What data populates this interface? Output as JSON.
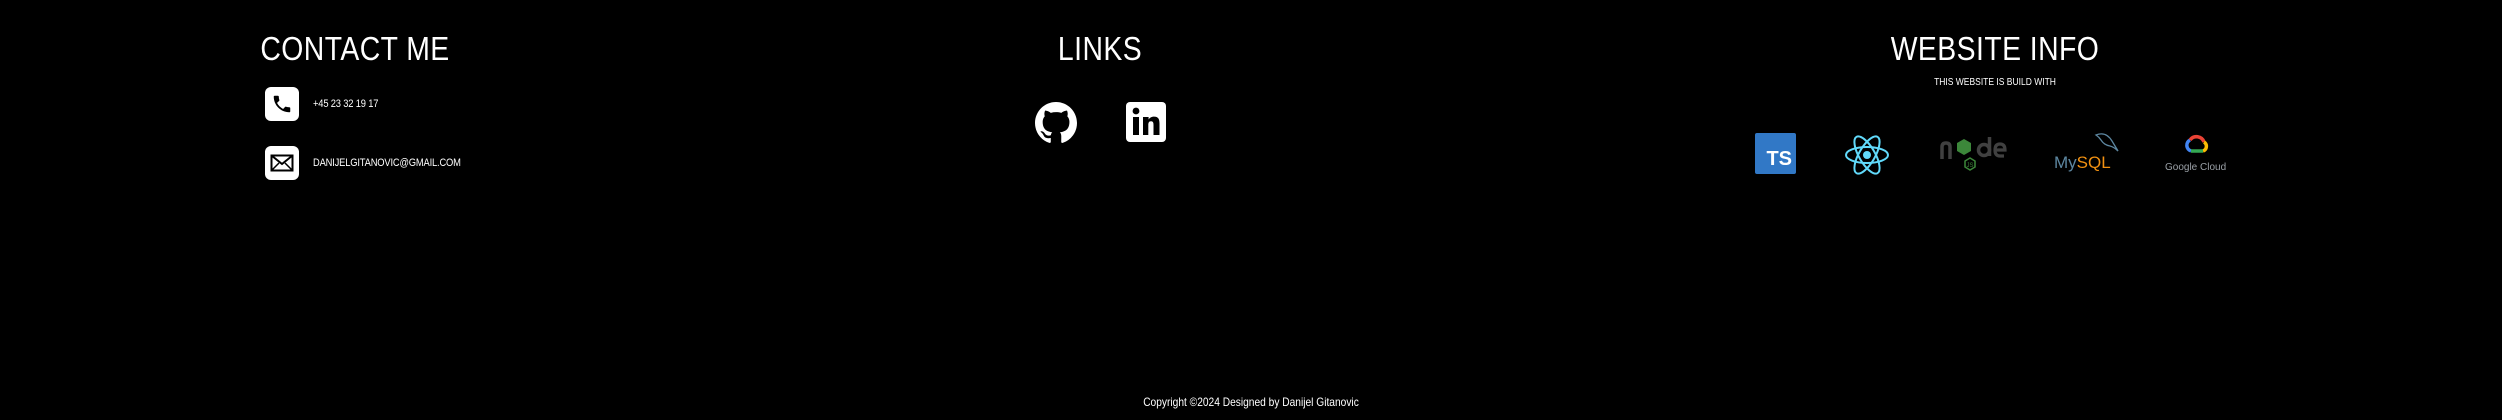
{
  "contact": {
    "title": "CONTACT ME",
    "phone": "+45 23 32 19 17",
    "email": "DANIJELGITANOVIC@GMAIL.COM"
  },
  "links": {
    "title": "LINKS",
    "items": [
      {
        "name": "GitHub",
        "icon": "github-icon"
      },
      {
        "name": "LinkedIn",
        "icon": "linkedin-icon"
      }
    ]
  },
  "website_info": {
    "title": "WEBSITE INFO",
    "subtitle": "THIS WEBSITE IS BUILD WITH",
    "technologies": [
      {
        "name": "TypeScript",
        "logo_text": "TS",
        "color": "#3178c6"
      },
      {
        "name": "React",
        "color": "#61dafb"
      },
      {
        "name": "Node",
        "logo_text": "node",
        "color": "#3c873a"
      },
      {
        "name": "MySQL",
        "logo_text_a": "My",
        "logo_text_b": "SQL",
        "color": "#5d87a1"
      },
      {
        "name": "Google Cloud",
        "logo_text": "Google Cloud",
        "color": "#9aa0a6"
      }
    ]
  },
  "footer": {
    "copyright": "Copyright ©2024 Designed by Danijel Gitanovic"
  },
  "colors": {
    "background": "#000000",
    "text": "#ffffff"
  }
}
